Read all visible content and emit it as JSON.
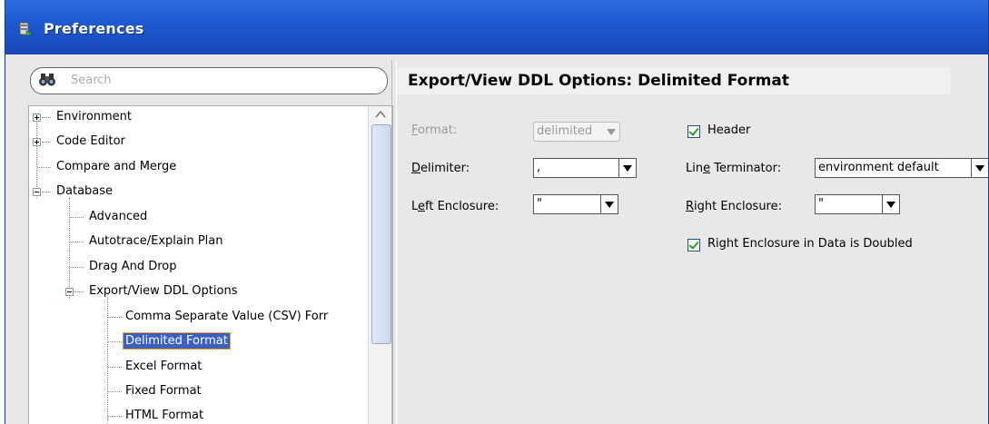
{
  "window": {
    "title": "Preferences"
  },
  "search": {
    "placeholder": "Search"
  },
  "tree": {
    "items": [
      {
        "label": "Environment"
      },
      {
        "label": "Code Editor"
      },
      {
        "label": "Compare and Merge"
      },
      {
        "label": "Database"
      },
      {
        "label": "Advanced"
      },
      {
        "label": "Autotrace/Explain Plan"
      },
      {
        "label": "Drag And Drop"
      },
      {
        "label": "Export/View DDL Options"
      },
      {
        "label": "Comma Separate Value (CSV) Forr"
      },
      {
        "label": "Delimited Format"
      },
      {
        "label": "Excel Format"
      },
      {
        "label": "Fixed Format"
      },
      {
        "label": "HTML Format"
      }
    ]
  },
  "panel": {
    "title": "Export/View DDL Options: Delimited Format",
    "format_label_mnemonic": "F",
    "format_label_rest": "ormat:",
    "format_value": "delimited",
    "delimiter_label_mnemonic": "D",
    "delimiter_label_rest": "elimiter:",
    "delimiter_value": ",",
    "left_enclosure_label_pre": "L",
    "left_enclosure_label_mnemonic": "e",
    "left_enclosure_label_rest": "ft Enclosure:",
    "left_enclosure_value": "\"",
    "header_label": "Header",
    "line_terminator_label_pre": "Lin",
    "line_terminator_label_mnemonic": "e",
    "line_terminator_label_rest": " Terminator:",
    "line_terminator_value": "environment default",
    "right_enclosure_label_mnemonic": "R",
    "right_enclosure_label_rest": "ight Enclosure:",
    "right_enclosure_value": "\"",
    "doubled_label": "Right Enclosure in Data is Doubled"
  }
}
